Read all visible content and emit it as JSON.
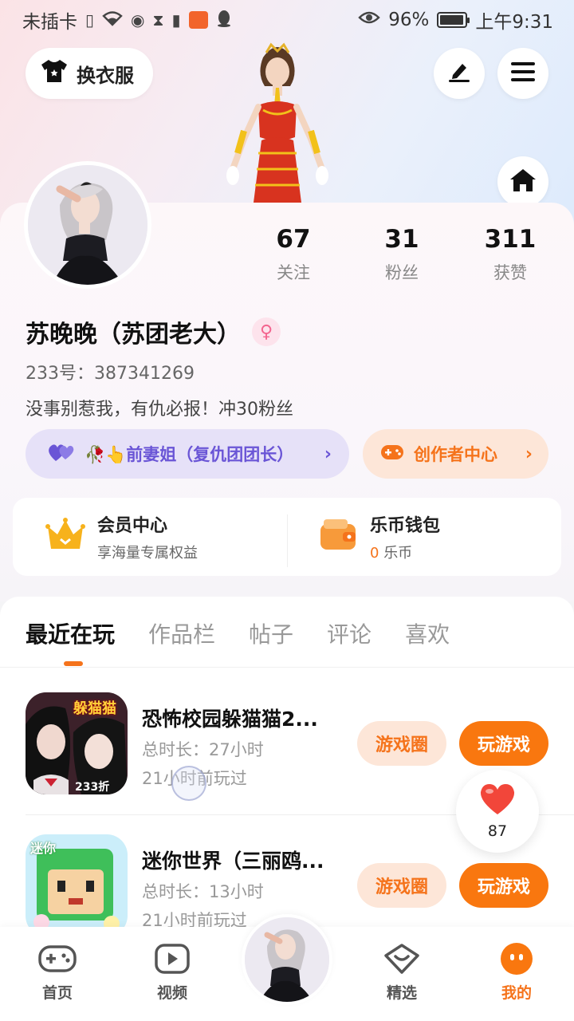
{
  "status_bar": {
    "carrier": "未插卡",
    "battery_percent": "96%",
    "battery_level": 0.96,
    "time": "上午9:31"
  },
  "header": {
    "outfit_button": "换衣服",
    "icons": [
      "tshirt-icon",
      "edit-icon",
      "menu-icon",
      "home-icon"
    ]
  },
  "profile": {
    "stats": [
      {
        "value": "67",
        "label": "关注"
      },
      {
        "value": "31",
        "label": "粉丝"
      },
      {
        "value": "311",
        "label": "获赞"
      }
    ],
    "name": "苏晚晚（苏团老大）",
    "gender_symbol": "♀",
    "uid": "233号：387341269",
    "bio": "没事别惹我，有仇必报！冲30粉丝",
    "title_chip": "🥀👆前妻姐（复仇团团长）",
    "creator_center": "创作者中心"
  },
  "wallet": {
    "vip": {
      "title": "会员中心",
      "subtitle": "享海量专属权益"
    },
    "coins": {
      "title": "乐币钱包",
      "amount": "0",
      "unit": "乐币"
    }
  },
  "tabs": [
    {
      "label": "最近在玩",
      "active": true
    },
    {
      "label": "作品栏",
      "active": false
    },
    {
      "label": "帖子",
      "active": false
    },
    {
      "label": "评论",
      "active": false
    },
    {
      "label": "喜欢",
      "active": false
    }
  ],
  "games": [
    {
      "title": "恐怖校园躲猫猫2...",
      "duration": "总时长：27小时",
      "last_played": "21小时前玩过",
      "icon_text": "躲猫猫",
      "icon_footer": "233折",
      "circle_button": "游戏圈",
      "play_button": "玩游戏"
    },
    {
      "title": "迷你世界（三丽鸥...",
      "duration": "总时长：13小时",
      "last_played": "21小时前玩过",
      "icon_text": "迷你",
      "circle_button": "游戏圈",
      "play_button": "玩游戏"
    }
  ],
  "like_bubble": {
    "count": "87"
  },
  "bottom_nav": [
    {
      "label": "首页",
      "icon": "gamepad-icon"
    },
    {
      "label": "视频",
      "icon": "video-play-icon"
    },
    {
      "label": "",
      "icon": "avatar-center"
    },
    {
      "label": "精选",
      "icon": "heart-box-icon"
    },
    {
      "label": "我的",
      "icon": "profile-face-icon",
      "active": true
    }
  ],
  "colors": {
    "accent": "#f9770f",
    "accent_soft": "#fde6d8",
    "purple": "#6a55d6",
    "purple_soft": "#e6e1f8"
  }
}
